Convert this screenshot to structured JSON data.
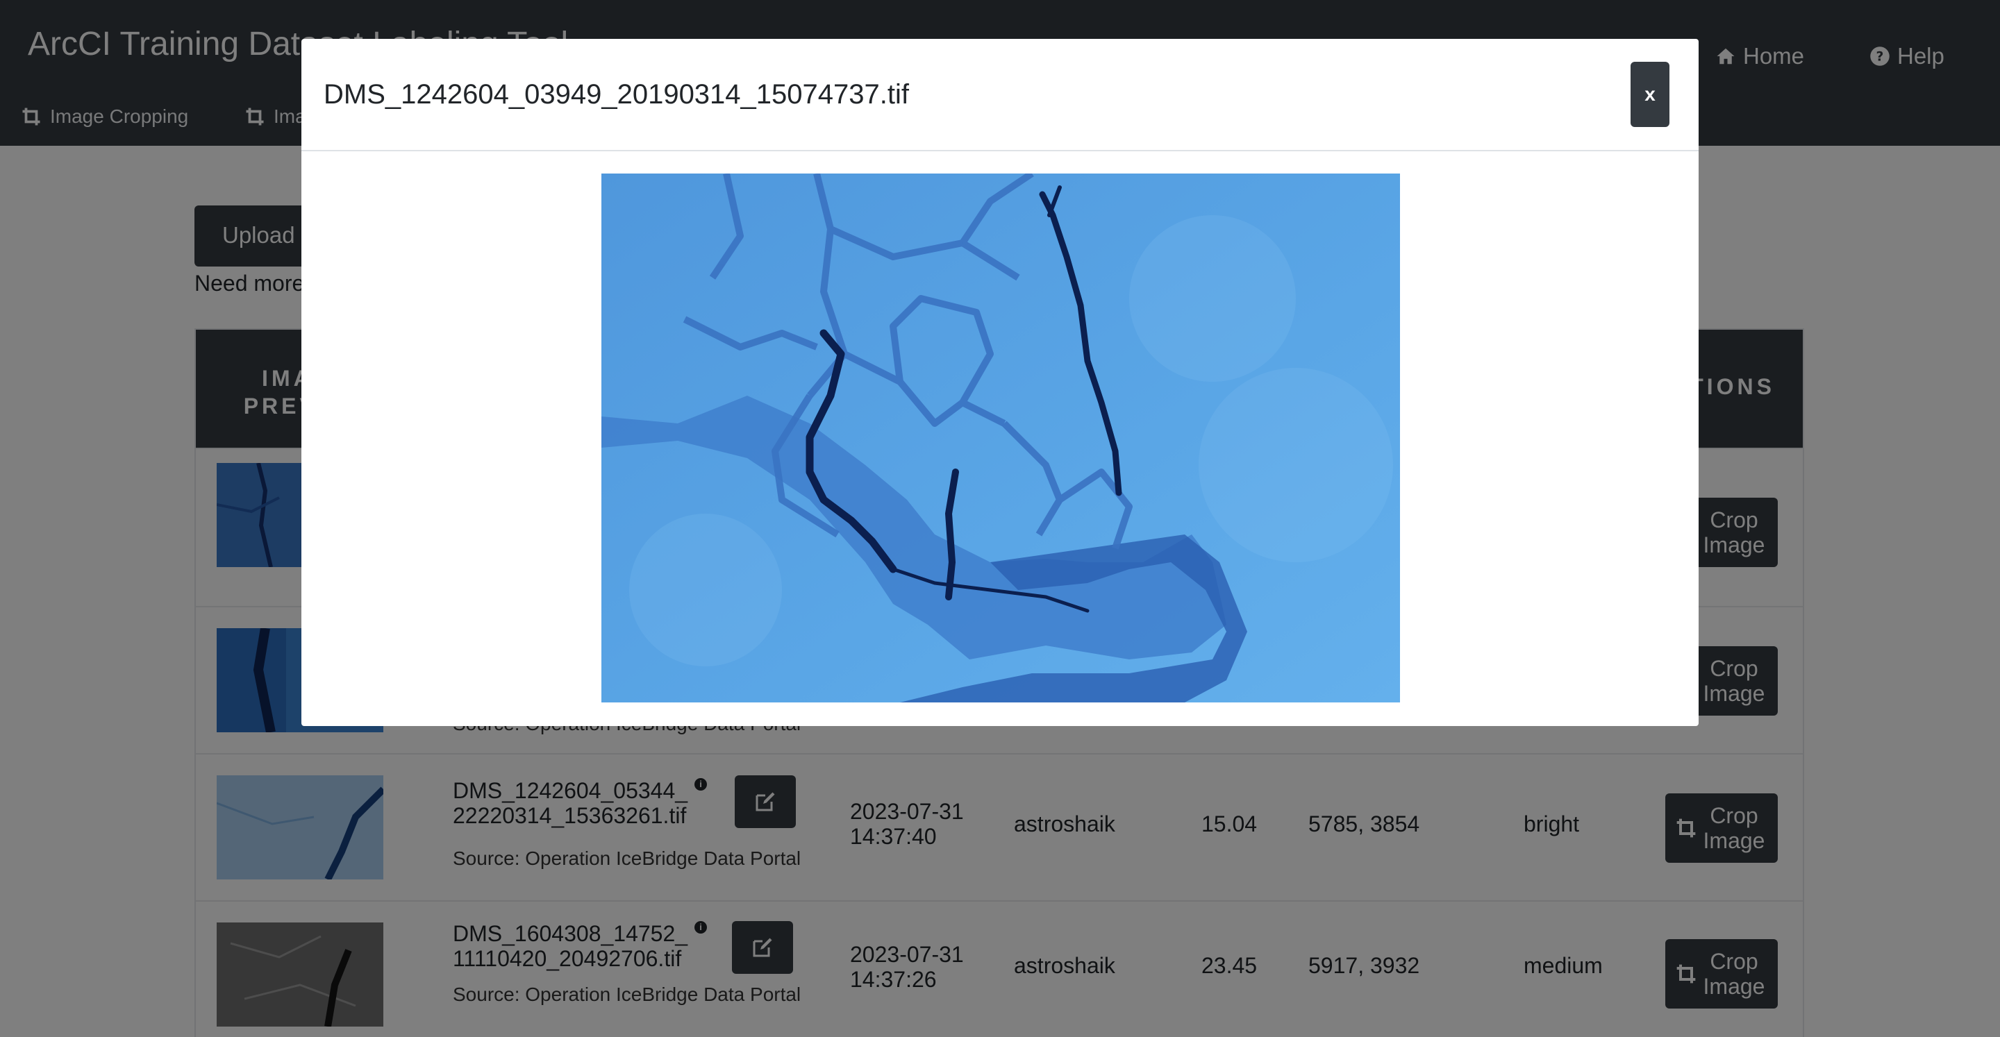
{
  "navbar": {
    "brand": "ArcCI Training Dataset Labeling Tool",
    "home_label": "Home",
    "help_label": "Help",
    "subnav": [
      {
        "label": "Image Cropping",
        "icon": "crop-icon"
      },
      {
        "label": "Image Labeling",
        "icon": "crop-icon"
      }
    ]
  },
  "page": {
    "upload_label": "Upload Image",
    "help_text": "Need more images?"
  },
  "table": {
    "headers": {
      "preview": "IMAGE PREVIEW",
      "actions": "ACTIONS"
    },
    "rows": [
      {
        "crop_label": "Crop Image"
      },
      {
        "source": "Source: Operation IceBridge Data Portal",
        "crop_label": "Crop Image"
      },
      {
        "filename_line1": "DMS_1242604_05344_",
        "filename_line2": "22220314_15363261.tif",
        "source": "Source: Operation IceBridge Data Portal",
        "date": "2023-07-31",
        "time": "14:37:40",
        "user": "astroshaik",
        "value": "15.04",
        "dimensions": "5785, 3854",
        "brightness": "bright",
        "crop_label": "Crop Image"
      },
      {
        "filename_line1": "DMS_1604308_14752_",
        "filename_line2": "11110420_20492706.tif",
        "source": "Source: Operation IceBridge Data Portal",
        "date": "2023-07-31",
        "time": "14:37:26",
        "user": "astroshaik",
        "value": "23.45",
        "dimensions": "5917, 3932",
        "brightness": "medium",
        "crop_label": "Crop Image"
      }
    ]
  },
  "modal": {
    "title": "DMS_1242604_03949_20190314_15074737.tif",
    "close_label": "x"
  },
  "colors": {
    "navbar": "#343a40",
    "button": "#343a40",
    "ice_light": "#5aa8e8",
    "ice_dark": "#1c3f8a"
  }
}
